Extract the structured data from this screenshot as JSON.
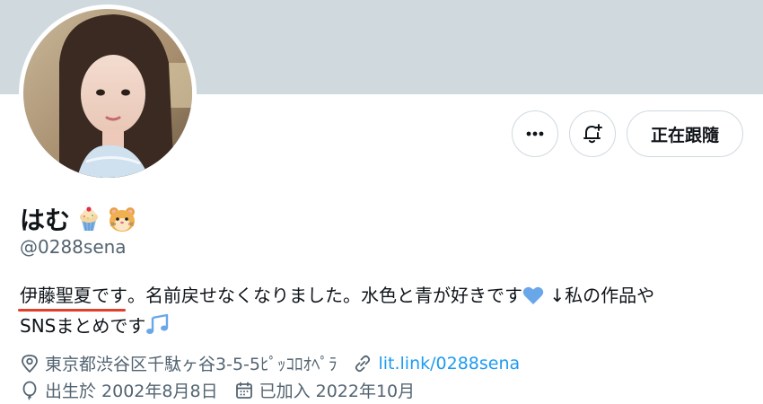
{
  "profile": {
    "display_name": "はむ",
    "handle": "@0288sena",
    "name_emojis": [
      "cupcake-emoji",
      "hamster-emoji"
    ]
  },
  "actions": {
    "more_icon": "more-horizontal-icon",
    "notify_icon": "bell-plus-icon",
    "follow_label": "正在跟隨"
  },
  "bio": {
    "part1": "伊藤聖夏です",
    "part2": "。名前戻せなくなりました。水色と青が好きです",
    "heart_icon": "blue-heart-emoji",
    "part3": " ↓私の作品や",
    "part4": "SNSまとめです",
    "music_icon": "music-notes-emoji"
  },
  "meta": {
    "location": "東京都渋谷区千駄ヶ谷3-5-5ﾋﾟｯｺﾛｵﾍﾟﾗ",
    "website": "lit.link/0288sena",
    "birthday": "出生於 2002年8月8日",
    "joined": "已加入 2022年10月"
  },
  "colors": {
    "banner": "#cfd9de",
    "link": "#1d9bf0",
    "secondary_text": "#536471",
    "underline": "#e0402a"
  }
}
